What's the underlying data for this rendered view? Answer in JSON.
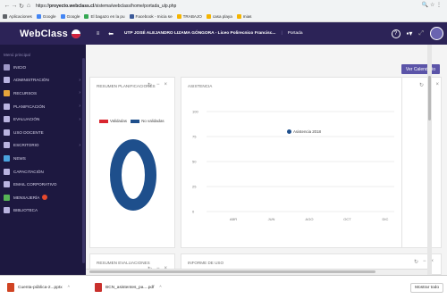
{
  "browser": {
    "url_prefix": "https://",
    "url_host": "proyecto.webclass.cl",
    "url_path": "/sistema/webclass/home/portada_ulp.php",
    "bookmarks": [
      "Aplicaciones",
      "Google",
      "Google",
      "El bagazo en la pu",
      "Facebook - Inicia se",
      "TRABAJO",
      "casa playa",
      "mias"
    ]
  },
  "brand": {
    "name": "WebClass"
  },
  "sidebar": {
    "title": "Menú principal",
    "items": [
      {
        "label": "INICIO",
        "arrow": false
      },
      {
        "label": "ADMINISTRACIÓN",
        "arrow": true
      },
      {
        "label": "RECURSOS",
        "arrow": true
      },
      {
        "label": "PLANIFICACIÓN",
        "arrow": true
      },
      {
        "label": "EVALUACIÓN",
        "arrow": true
      },
      {
        "label": "USO DOCENTE",
        "arrow": false
      },
      {
        "label": "ESCRITORIO",
        "arrow": true
      },
      {
        "label": "NEWS",
        "arrow": false
      },
      {
        "label": "CAPACITACIÓN",
        "arrow": false
      },
      {
        "label": "EMAIL CORPORATIVO",
        "arrow": false
      },
      {
        "label": "MENSAJERÍA",
        "arrow": false
      },
      {
        "label": "BIBLIOTECA",
        "arrow": false
      }
    ]
  },
  "topbar": {
    "user": "UTP JOSÉ ALEJANDRO LIZAMA GÓNGORA - Liceo Polirecnico Francisc...",
    "section": "Portada"
  },
  "content": {
    "calendar_button": "Ver Calendario",
    "planning_card": {
      "title": "RESUMEN PLANIFICACIONES",
      "legend": [
        "Validadas",
        "No validadas"
      ]
    },
    "attendance_card": {
      "title": "ASISTENCIA",
      "legend": "Asistencia 2018"
    },
    "evaluations_card": {
      "title": "RESUMEN EVALUACIONES"
    },
    "usage_card": {
      "title": "INFORME DE USO"
    }
  },
  "chart_data": [
    {
      "type": "pie",
      "title": "RESUMEN PLANIFICACIONES",
      "categories": [
        "Validadas",
        "No validadas"
      ],
      "values": [
        0,
        100
      ],
      "colors": [
        "#d9262f",
        "#1e4f8c"
      ]
    },
    {
      "type": "line",
      "title": "ASISTENCIA",
      "categories": [
        "ABR",
        "JUN",
        "AGO",
        "OCT",
        "DIC"
      ],
      "series": [
        {
          "name": "Asistencia 2018",
          "values": []
        }
      ],
      "y_ticks": [
        "100",
        "75",
        "50",
        "25",
        "0"
      ],
      "ylim": [
        0,
        100
      ]
    }
  ],
  "downloads": [
    {
      "name": "Cuenta-pública-2...pptx"
    },
    {
      "name": "BCN_asistentes_pa....pdf"
    }
  ],
  "downloads_show_all": "Mostrar todo"
}
